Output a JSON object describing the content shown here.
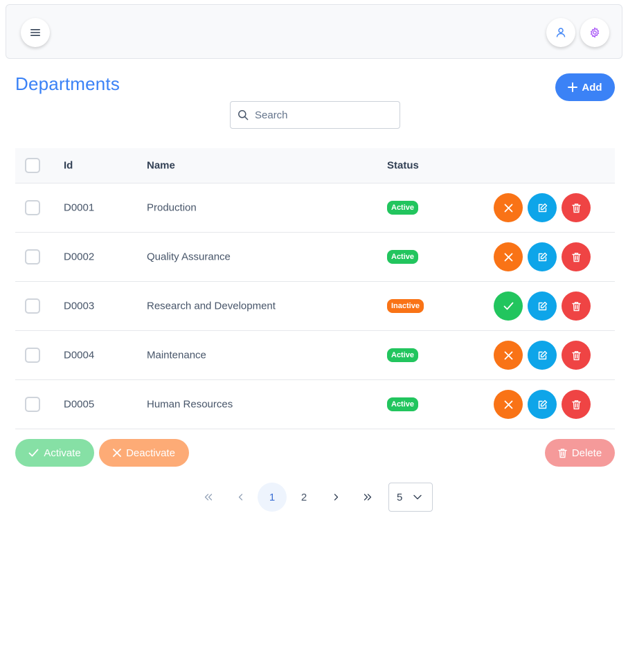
{
  "header": {
    "menu_icon": "hamburger-menu-icon",
    "user_icon": "user-icon",
    "settings_icon": "gear-icon"
  },
  "page": {
    "title": "Departments",
    "add_label": "Add"
  },
  "search": {
    "placeholder": "Search",
    "value": ""
  },
  "table": {
    "columns": [
      "Id",
      "Name",
      "Status"
    ],
    "rows": [
      {
        "id": "D0001",
        "name": "Production",
        "status": "Active"
      },
      {
        "id": "D0002",
        "name": "Quality Assurance",
        "status": "Active"
      },
      {
        "id": "D0003",
        "name": "Research and Development",
        "status": "Inactive"
      },
      {
        "id": "D0004",
        "name": "Maintenance",
        "status": "Active"
      },
      {
        "id": "D0005",
        "name": "Human Resources",
        "status": "Active"
      }
    ]
  },
  "bulk_actions": {
    "activate_label": "Activate",
    "deactivate_label": "Deactivate",
    "delete_label": "Delete"
  },
  "pagination": {
    "pages": [
      "1",
      "2"
    ],
    "current_page": "1",
    "rows_per_page": "5"
  },
  "colors": {
    "primary": "#3b82f6",
    "active_badge": "#22c55e",
    "inactive_badge": "#f97316",
    "deactivate_action": "#f97316",
    "activate_action": "#22c55e",
    "edit_action": "#0ea5e9",
    "delete_action": "#ef4444"
  }
}
